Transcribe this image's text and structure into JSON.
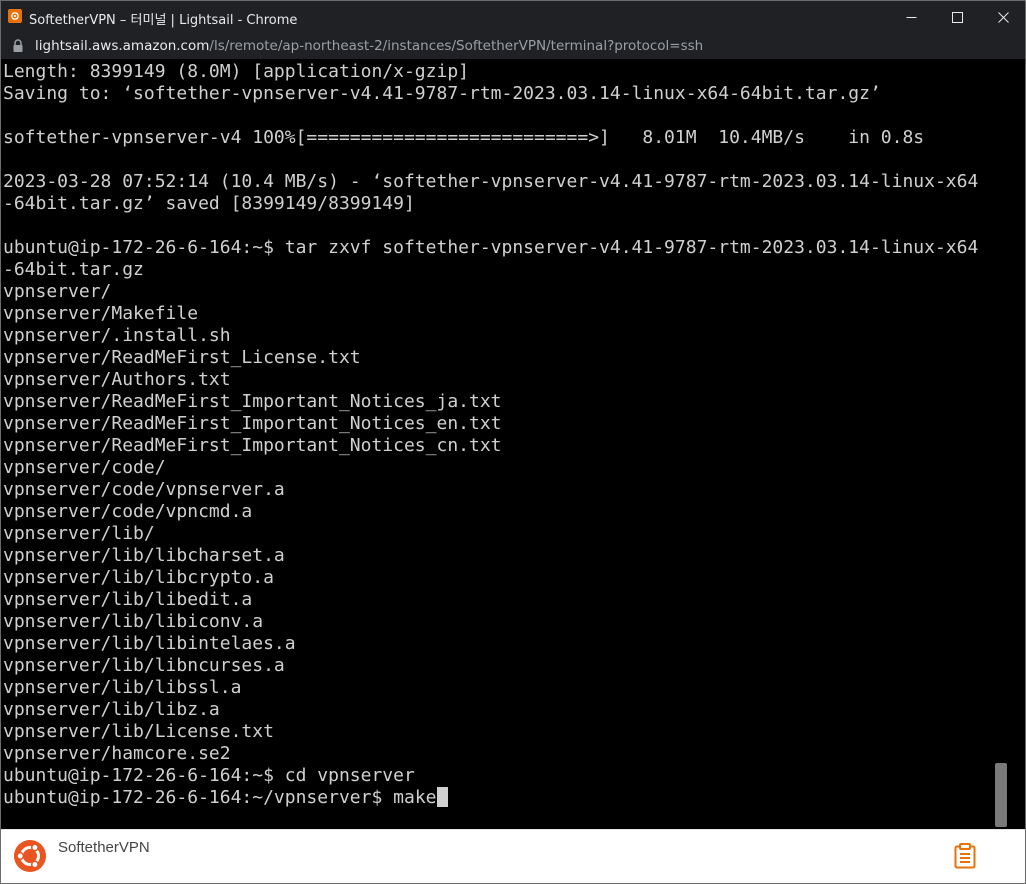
{
  "window": {
    "title": "SoftetherVPN – 터미널 | Lightsail - Chrome",
    "controls": {
      "minimize": "—",
      "maximize": "☐",
      "close": "✕"
    }
  },
  "address_bar": {
    "host": "lightsail.aws.amazon.com",
    "path": "/ls/remote/ap-northeast-2/instances/SoftetherVPN/terminal?protocol=ssh"
  },
  "terminal": {
    "lines": [
      "Length: 8399149 (8.0M) [application/x-gzip]",
      "Saving to: ‘softether-vpnserver-v4.41-9787-rtm-2023.03.14-linux-x64-64bit.tar.gz’",
      "",
      "softether-vpnserver-v4 100%[==========================>]   8.01M  10.4MB/s    in 0.8s",
      "",
      "2023-03-28 07:52:14 (10.4 MB/s) - ‘softether-vpnserver-v4.41-9787-rtm-2023.03.14-linux-x64",
      "-64bit.tar.gz’ saved [8399149/8399149]",
      "",
      "ubuntu@ip-172-26-6-164:~$ tar zxvf softether-vpnserver-v4.41-9787-rtm-2023.03.14-linux-x64",
      "-64bit.tar.gz",
      "vpnserver/",
      "vpnserver/Makefile",
      "vpnserver/.install.sh",
      "vpnserver/ReadMeFirst_License.txt",
      "vpnserver/Authors.txt",
      "vpnserver/ReadMeFirst_Important_Notices_ja.txt",
      "vpnserver/ReadMeFirst_Important_Notices_en.txt",
      "vpnserver/ReadMeFirst_Important_Notices_cn.txt",
      "vpnserver/code/",
      "vpnserver/code/vpnserver.a",
      "vpnserver/code/vpncmd.a",
      "vpnserver/lib/",
      "vpnserver/lib/libcharset.a",
      "vpnserver/lib/libcrypto.a",
      "vpnserver/lib/libedit.a",
      "vpnserver/lib/libiconv.a",
      "vpnserver/lib/libintelaes.a",
      "vpnserver/lib/libncurses.a",
      "vpnserver/lib/libssl.a",
      "vpnserver/lib/libz.a",
      "vpnserver/lib/License.txt",
      "vpnserver/hamcore.se2",
      "ubuntu@ip-172-26-6-164:~$ cd vpnserver"
    ],
    "prompt": "ubuntu@ip-172-26-6-164:~/vpnserver$ ",
    "current_input": "make"
  },
  "footer": {
    "instance_name": "SoftetherVPN",
    "os_icon": "ubuntu-logo-icon",
    "action_icon": "clipboard-icon"
  },
  "colors": {
    "chrome_bg": "#202124",
    "terminal_bg": "#000000",
    "terminal_fg": "#d0d0d0",
    "ubuntu_orange": "#e95420"
  }
}
